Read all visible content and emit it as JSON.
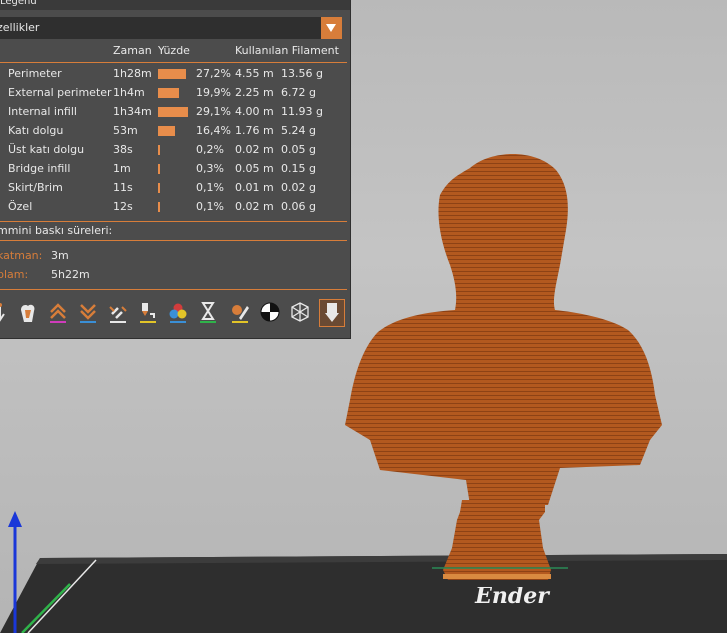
{
  "legend": {
    "title": "Legend",
    "view_selector": {
      "value": "zellikler"
    },
    "columns": {
      "time": "Zaman",
      "percent": "Yüzde",
      "used_filament": "Kullanılan Filament"
    },
    "rows": [
      {
        "name": "Perimeter",
        "time": "1h28m",
        "percent": "27,2%",
        "length": "4.55 m",
        "weight": "13.56 g",
        "fraction": 0.272
      },
      {
        "name": "External perimeter",
        "time": "1h4m",
        "percent": "19,9%",
        "length": "2.25 m",
        "weight": "6.72 g",
        "fraction": 0.199
      },
      {
        "name": "Internal infill",
        "time": "1h34m",
        "percent": "29,1%",
        "length": "4.00 m",
        "weight": "11.93 g",
        "fraction": 0.291
      },
      {
        "name": "Katı dolgu",
        "time": "53m",
        "percent": "16,4%",
        "length": "1.76 m",
        "weight": "5.24 g",
        "fraction": 0.164
      },
      {
        "name": "Üst katı dolgu",
        "time": "38s",
        "percent": "0,2%",
        "length": "0.02 m",
        "weight": "0.05 g",
        "fraction": 0.002
      },
      {
        "name": "Bridge infill",
        "time": "1m",
        "percent": "0,3%",
        "length": "0.05 m",
        "weight": "0.15 g",
        "fraction": 0.003
      },
      {
        "name": "Skirt/Brim",
        "time": "11s",
        "percent": "0,1%",
        "length": "0.01 m",
        "weight": "0.02 g",
        "fraction": 0.001
      },
      {
        "name": "Özel",
        "time": "12s",
        "percent": "0,1%",
        "length": "0.02 m",
        "weight": "0.06 g",
        "fraction": 0.001
      }
    ],
    "estimate_title": "mmini baskı süreleri:",
    "first_layer_label": "katman:",
    "first_layer_value": "3m",
    "total_label": "plam:",
    "total_value": "5h22m",
    "colors": {
      "accent": "#d77d3a",
      "bar": "#e88d4b",
      "panel": "#4c4c4c"
    }
  },
  "toolbar": {
    "icons": [
      "travel-icon",
      "wipe-icon",
      "retractions-icon",
      "deretractions-icon",
      "seams-icon",
      "tool-changes-icon",
      "color-changes-icon",
      "pause-icon",
      "custom-gcode-icon",
      "center-of-gravity-icon",
      "shells-icon",
      "tool-marker-icon"
    ]
  },
  "scene": {
    "model_color": "#b3591f",
    "bed_label": "Ender"
  }
}
